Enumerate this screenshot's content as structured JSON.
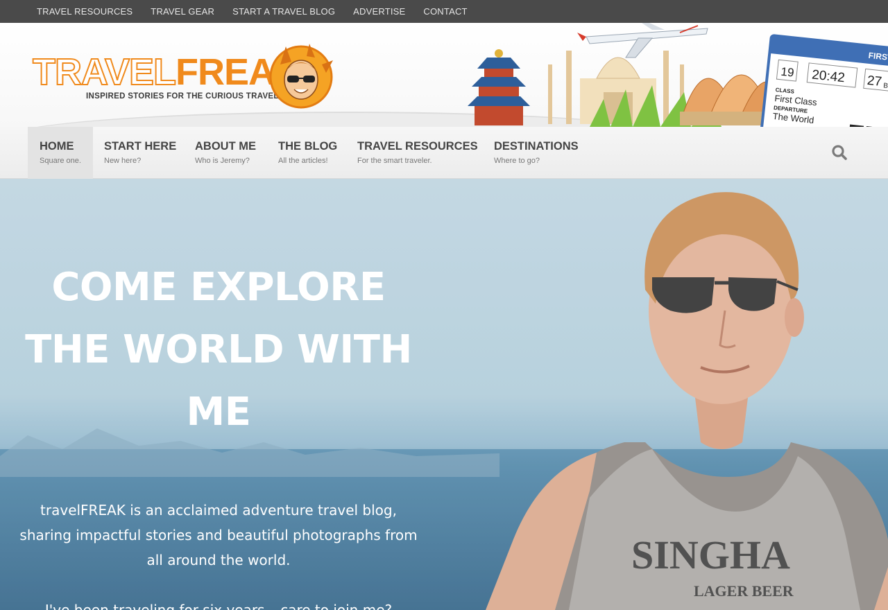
{
  "topbar": {
    "items": [
      "TRAVEL RESOURCES",
      "TRAVEL GEAR",
      "START A TRAVEL BLOG",
      "ADVERTISE",
      "CONTACT"
    ]
  },
  "logo": {
    "word1": "TRAVEL",
    "word2": "FREAK",
    "tagline": "INSPIRED STORIES FOR THE CURIOUS TRAVELER"
  },
  "ticket": {
    "header": "FIRST CL",
    "gate": "19",
    "time": "20:42",
    "seat": "27",
    "seat_suffix": "B",
    "class_label": "CLASS",
    "class_value": "First Class",
    "departure_label": "DEPARTURE",
    "departure_value": "The World"
  },
  "nav": {
    "items": [
      {
        "title": "HOME",
        "subtitle": "Square one."
      },
      {
        "title": "START HERE",
        "subtitle": "New here?"
      },
      {
        "title": "ABOUT ME",
        "subtitle": "Who is Jeremy?"
      },
      {
        "title": "THE BLOG",
        "subtitle": "All the articles!"
      },
      {
        "title": "TRAVEL RESOURCES",
        "subtitle": "For the smart traveler."
      },
      {
        "title": "DESTINATIONS",
        "subtitle": "Where to go?"
      }
    ],
    "search_icon": "search-icon"
  },
  "hero": {
    "headline": "COME EXPLORE THE WORLD WITH ME",
    "intro": "travelFREAK is an acclaimed adventure travel blog, sharing impactful stories and beautiful photographs from all around the world.",
    "invite": "I've been traveling for six years – care to join me?",
    "shirt_text": "SINGHA",
    "shirt_subtext": "LAGER BEER"
  },
  "colors": {
    "brand_orange": "#f08a1c",
    "topbar_bg": "#4a4a4a",
    "nav_text": "#444444"
  }
}
